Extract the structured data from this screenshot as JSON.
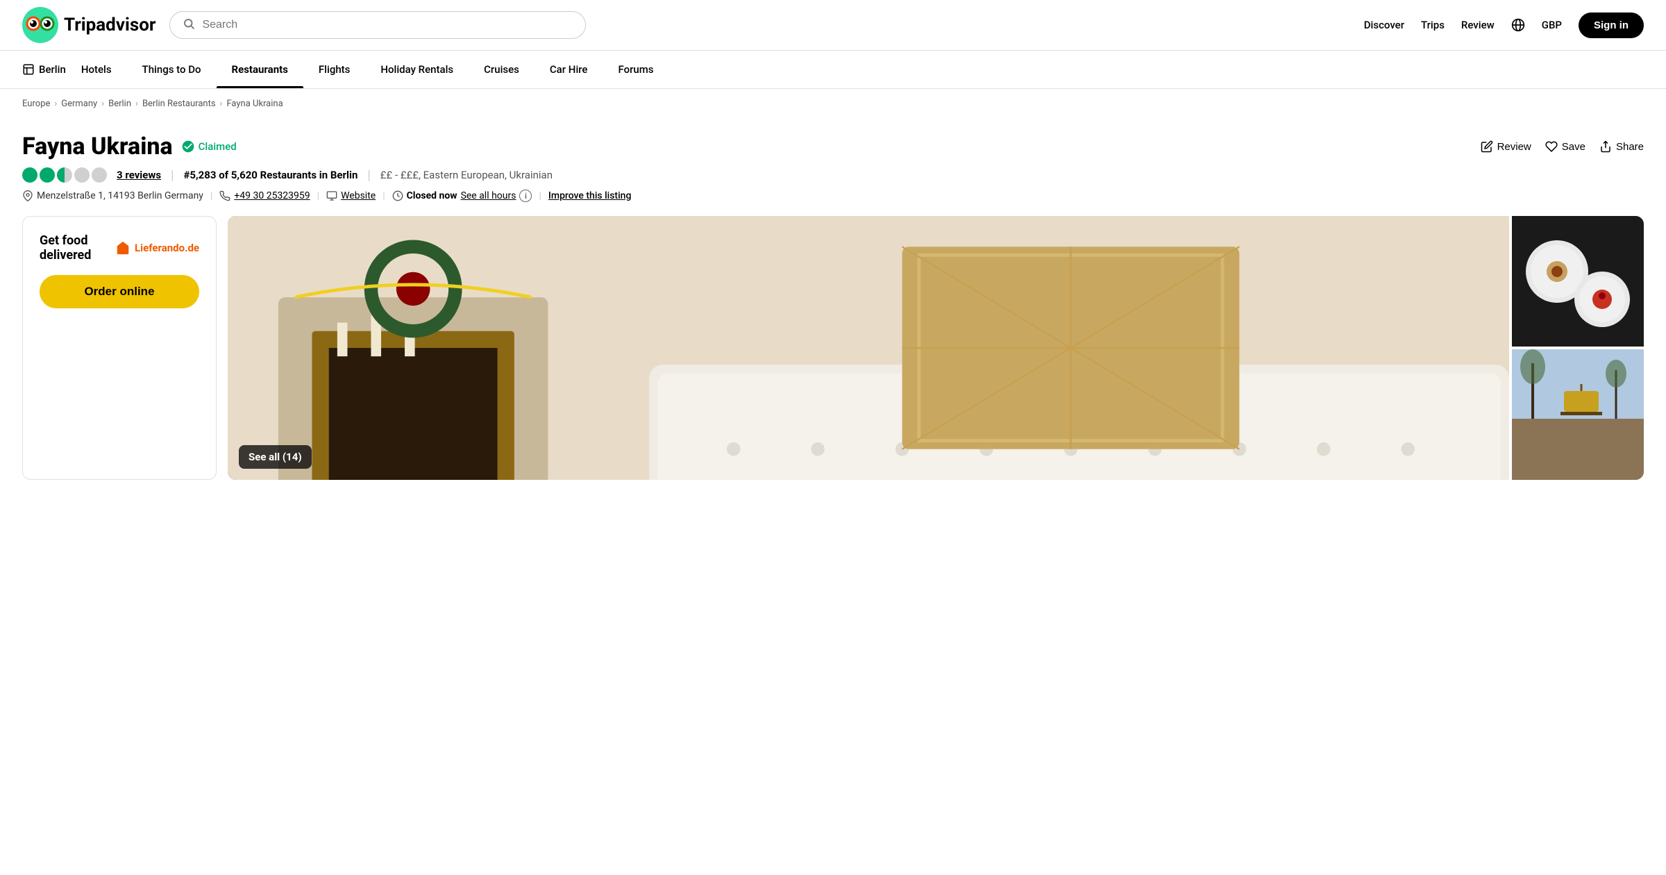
{
  "header": {
    "logo_text": "Tripadvisor",
    "search_placeholder": "Search",
    "nav_items": [
      "Discover",
      "Trips",
      "Review"
    ],
    "currency": "GBP",
    "sign_in": "Sign in"
  },
  "sub_nav": {
    "location": "Berlin",
    "items": [
      {
        "label": "Hotels",
        "active": false
      },
      {
        "label": "Things to Do",
        "active": false
      },
      {
        "label": "Restaurants",
        "active": true
      },
      {
        "label": "Flights",
        "active": false
      },
      {
        "label": "Holiday Rentals",
        "active": false
      },
      {
        "label": "Cruises",
        "active": false
      },
      {
        "label": "Car Hire",
        "active": false
      },
      {
        "label": "Forums",
        "active": false
      }
    ]
  },
  "breadcrumb": {
    "items": [
      "Europe",
      "Germany",
      "Berlin",
      "Berlin Restaurants",
      "Fayna Ukraina"
    ]
  },
  "restaurant": {
    "name": "Fayna Ukraina",
    "claimed": "Claimed",
    "review_label": "Review",
    "save_label": "Save",
    "share_label": "Share",
    "rating_count": 3,
    "reviews_text": "3 reviews",
    "ranking": "#5,283",
    "total_restaurants": "5,620",
    "ranking_full": "#5,283 of 5,620 Restaurants in Berlin",
    "pricing": "££ - £££, Eastern European, Ukrainian",
    "address": "Menzelstraße 1, 14193 Berlin Germany",
    "phone": "+49 30 25323959",
    "website_label": "Website",
    "status": "Closed now",
    "hours_label": "See all hours",
    "improve_label": "Improve this listing"
  },
  "delivery": {
    "title": "Get food delivered",
    "brand": "Lieferando.de",
    "order_label": "Order online"
  },
  "photos": {
    "see_all_label": "See all (14)"
  },
  "colors": {
    "green": "#00aa6c",
    "yellow": "#f0c300",
    "orange": "#f05b00",
    "black": "#000000",
    "white": "#ffffff"
  }
}
